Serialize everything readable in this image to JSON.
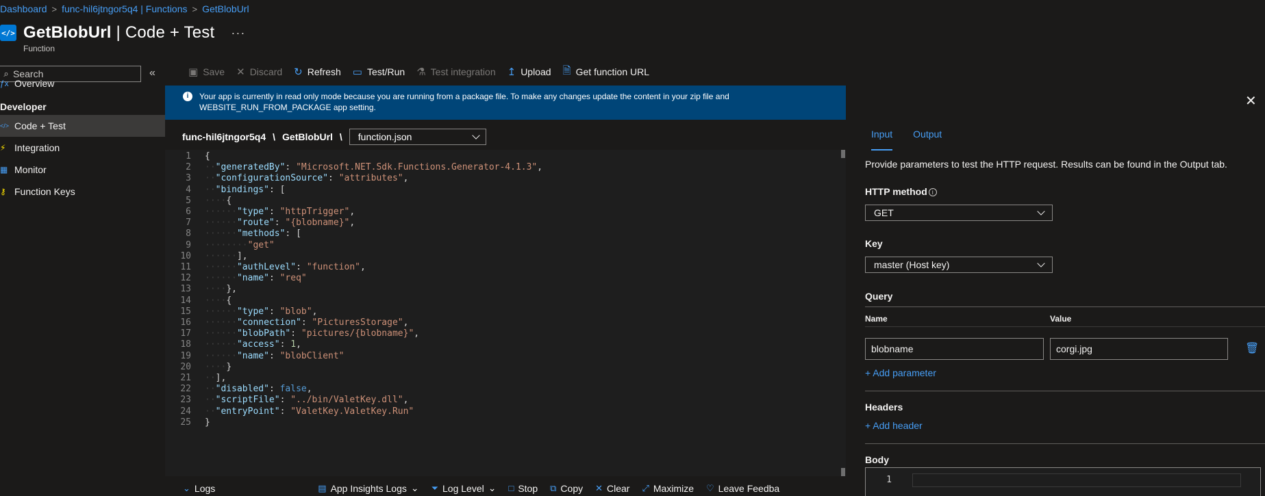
{
  "breadcrumb": {
    "items": [
      "Dashboard",
      "func-hil6jtngor5q4 | Functions",
      "GetBlobUrl"
    ],
    "separator": ">"
  },
  "header": {
    "icon": "function-icon",
    "icon_glyph": "</>",
    "title_bold": "GetBlobUrl",
    "title_rest": " | Code + Test",
    "more": "···",
    "subtitle": "Function"
  },
  "sidebar": {
    "search_placeholder": "Search",
    "collapse": "«",
    "overview": "Overview",
    "section_developer": "Developer",
    "items": [
      {
        "label": "Code + Test",
        "icon": "code-icon",
        "glyph": "</>",
        "color": "#479ef5",
        "active": true
      },
      {
        "label": "Integration",
        "icon": "lightning-icon",
        "glyph": "⚡",
        "color": "#fce100",
        "active": false
      },
      {
        "label": "Monitor",
        "icon": "monitor-icon",
        "glyph": "▦",
        "color": "#479ef5",
        "active": false
      },
      {
        "label": "Function Keys",
        "icon": "key-icon",
        "glyph": "🔑",
        "color": "#fce100",
        "active": false
      }
    ]
  },
  "toolbar": {
    "save": "Save",
    "discard": "Discard",
    "refresh": "Refresh",
    "test_run": "Test/Run",
    "test_integration": "Test integration",
    "upload": "Upload",
    "get_function_url": "Get function URL"
  },
  "info_bar": {
    "message": "Your app is currently in read only mode because you are running from a package file. To make any changes update the content in your zip file and WEBSITE_RUN_FROM_PACKAGE app setting."
  },
  "path": {
    "app": "func-hil6jtngor5q4",
    "function": "GetBlobUrl",
    "separator": "\\",
    "file": "function.json"
  },
  "editor": {
    "lines": [
      "{",
      "  \"generatedBy\": \"Microsoft.NET.Sdk.Functions.Generator-4.1.3\",",
      "  \"configurationSource\": \"attributes\",",
      "  \"bindings\": [",
      "    {",
      "      \"type\": \"httpTrigger\",",
      "      \"route\": \"{blobname}\",",
      "      \"methods\": [",
      "        \"get\"",
      "      ],",
      "      \"authLevel\": \"function\",",
      "      \"name\": \"req\"",
      "    },",
      "    {",
      "      \"type\": \"blob\",",
      "      \"connection\": \"PicturesStorage\",",
      "      \"blobPath\": \"pictures/{blobname}\",",
      "      \"access\": 1,",
      "      \"name\": \"blobClient\"",
      "    }",
      "  ],",
      "  \"disabled\": false,",
      "  \"scriptFile\": \"../bin/ValetKey.dll\",",
      "  \"entryPoint\": \"ValetKey.ValetKey.Run\"",
      "}"
    ]
  },
  "bottom_bar": {
    "logs": "Logs",
    "app_insights_logs": "App Insights Logs",
    "log_level": "Log Level",
    "stop": "Stop",
    "copy": "Copy",
    "clear": "Clear",
    "maximize": "Maximize",
    "leave_feedback": "Leave Feedba"
  },
  "panel": {
    "close": "✕",
    "tabs": [
      "Input",
      "Output"
    ],
    "active_tab": "Input",
    "description": "Provide parameters to test the HTTP request. Results can be found in the Output tab.",
    "http_method_label": "HTTP method",
    "http_method_value": "GET",
    "key_label": "Key",
    "key_value": "master (Host key)",
    "query_label": "Query",
    "query_col_name": "Name",
    "query_col_value": "Value",
    "query_name": "blobname",
    "query_value": "corgi.jpg",
    "add_parameter": "+ Add parameter",
    "headers_label": "Headers",
    "add_header": "+ Add header",
    "body_label": "Body",
    "body_line_number": "1"
  },
  "colors": {
    "accent": "#479ef5",
    "background": "#1b1a19",
    "info_bar": "#004578",
    "editor_bg": "#1e1e1e"
  }
}
